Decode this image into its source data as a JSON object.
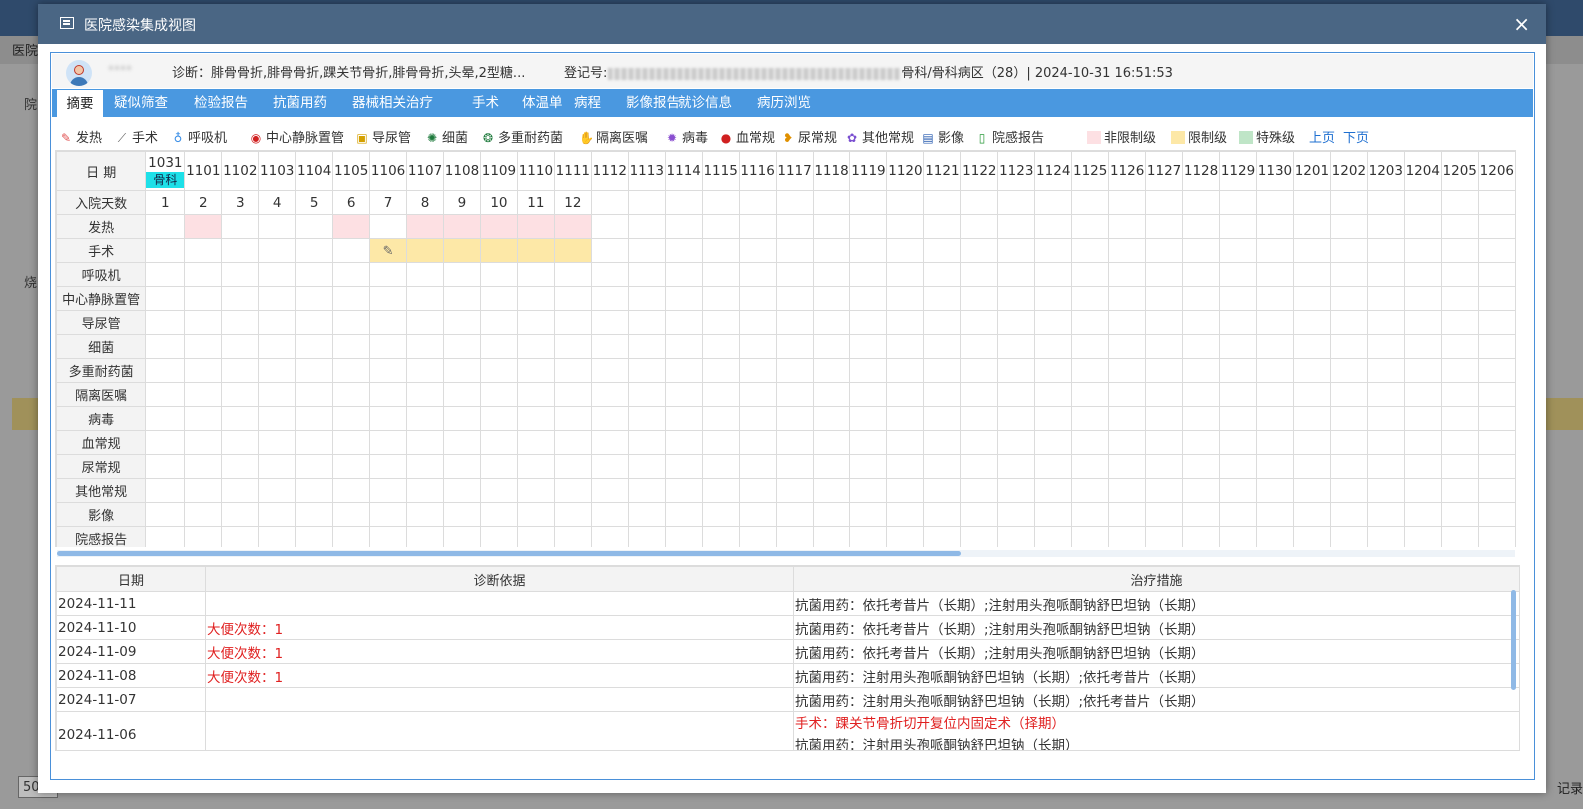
{
  "background": {
    "tab_label": "医院",
    "fragment_labels": [
      "院",
      "烧"
    ],
    "page_size": "50",
    "right_text": "记录"
  },
  "modal": {
    "title": "医院感染集成视图",
    "close_glyph": "×"
  },
  "patient": {
    "name_blurred": "****",
    "diagnosis": "诊断：腓骨骨折,腓骨骨折,踝关节骨折,腓骨骨折,头晕,2型糖...",
    "reg_label": "登记号:",
    "reg_suffix": "骨科/骨科病区（28）| 2024-10-31 16:51:53"
  },
  "tabs": [
    "摘要",
    "疑似筛查",
    "检验报告",
    "抗菌用药",
    "器械相关治疗",
    "手术",
    "体温单",
    "病程",
    "影像报告",
    "就诊信息",
    "病历浏览"
  ],
  "legend": [
    {
      "label": "发热",
      "icon": "thermometer-icon",
      "glyph": "✎",
      "color": "#e05050"
    },
    {
      "label": "手术",
      "icon": "scalpel-icon",
      "glyph": "⟋",
      "color": "#666666"
    },
    {
      "label": "呼吸机",
      "icon": "ventilator-icon",
      "glyph": "♁",
      "color": "#3a8ee6"
    },
    {
      "label": "中心静脉置管",
      "icon": "catheter-icon",
      "glyph": "◉",
      "color": "#d02020"
    },
    {
      "label": "导尿管",
      "icon": "urinary-catheter-icon",
      "glyph": "▣",
      "color": "#d4a000"
    },
    {
      "label": "细菌",
      "icon": "bacteria-icon",
      "glyph": "✺",
      "color": "#1e7a3c"
    },
    {
      "label": "多重耐药菌",
      "icon": "mdro-icon",
      "glyph": "❂",
      "color": "#1e7a3c"
    },
    {
      "label": "隔离医嘱",
      "icon": "isolation-icon",
      "glyph": "✋",
      "color": "#2255aa"
    },
    {
      "label": "病毒",
      "icon": "virus-icon",
      "glyph": "✹",
      "color": "#8a4fd0"
    },
    {
      "label": "血常规",
      "icon": "blood-drop-icon",
      "glyph": "●",
      "color": "#d02020"
    },
    {
      "label": "尿常规",
      "icon": "kidney-icon",
      "glyph": "❥",
      "color": "#e09000"
    },
    {
      "label": "其他常规",
      "icon": "gear-icon",
      "glyph": "✿",
      "color": "#7a4fd0"
    },
    {
      "label": "影像",
      "icon": "xray-icon",
      "glyph": "▤",
      "color": "#2a5db0"
    },
    {
      "label": "院感报告",
      "icon": "report-icon",
      "glyph": "▯",
      "color": "#2a9a3a"
    }
  ],
  "swatches": [
    {
      "label": "非限制级",
      "color": "#fde0e3"
    },
    {
      "label": "限制级",
      "color": "#fde8a7"
    },
    {
      "label": "特殊级",
      "color": "#bfe5c7"
    }
  ],
  "paging": {
    "prev": "上页",
    "next": "下页"
  },
  "grid": {
    "date_header": "日 期",
    "days_header": "入院天数",
    "ward_label": "骨科",
    "dates": [
      "1031",
      "1101",
      "1102",
      "1103",
      "1104",
      "1105",
      "1106",
      "1107",
      "1108",
      "1109",
      "1110",
      "1111",
      "1112",
      "1113",
      "1114",
      "1115",
      "1116",
      "1117",
      "1118",
      "1119",
      "1120",
      "1121",
      "1122",
      "1123",
      "1124",
      "1125",
      "1126",
      "1127",
      "1128",
      "1129",
      "1130",
      "1201",
      "1202",
      "1203",
      "1204",
      "1205",
      "1206"
    ],
    "days": [
      "1",
      "2",
      "3",
      "4",
      "5",
      "6",
      "7",
      "8",
      "9",
      "10",
      "11",
      "12"
    ],
    "rows": [
      "发热",
      "手术",
      "呼吸机",
      "中心静脉置管",
      "导尿管",
      "细菌",
      "多重耐药菌",
      "隔离医嘱",
      "病毒",
      "血常规",
      "尿常规",
      "其他常规",
      "影像",
      "院感报告"
    ],
    "fever_cols": [
      1,
      5,
      7,
      8,
      9,
      10,
      11
    ],
    "surgery_cols": [
      6,
      7,
      8,
      9,
      10,
      11
    ],
    "surgery_mark_col": 6
  },
  "scroll": {
    "horizontal_fraction": 0.62
  },
  "diagnosis_table": {
    "headers": [
      "日期",
      "诊断依据",
      "治疗措施"
    ],
    "rows": [
      {
        "date": "2024-11-11",
        "basis": "",
        "treat": [
          "抗菌用药：依托考昔片（长期）;注射用头孢哌酮钠舒巴坦钠（长期）"
        ]
      },
      {
        "date": "2024-11-10",
        "basis": "大便次数：1",
        "treat": [
          "抗菌用药：依托考昔片（长期）;注射用头孢哌酮钠舒巴坦钠（长期）"
        ]
      },
      {
        "date": "2024-11-09",
        "basis": "大便次数：1",
        "treat": [
          "抗菌用药：依托考昔片（长期）;注射用头孢哌酮钠舒巴坦钠（长期）"
        ]
      },
      {
        "date": "2024-11-08",
        "basis": "大便次数：1",
        "treat": [
          "抗菌用药：注射用头孢哌酮钠舒巴坦钠（长期）;依托考昔片（长期）"
        ]
      },
      {
        "date": "2024-11-07",
        "basis": "",
        "treat": [
          "抗菌用药：注射用头孢哌酮钠舒巴坦钠（长期）;依托考昔片（长期）"
        ]
      },
      {
        "date": "2024-11-06",
        "basis": "",
        "surgery": "手术：踝关节骨折切开复位内固定术（择期）",
        "treat": [
          "抗菌用药：注射用头孢哌酮钠舒巴坦钠（长期）"
        ]
      }
    ]
  }
}
